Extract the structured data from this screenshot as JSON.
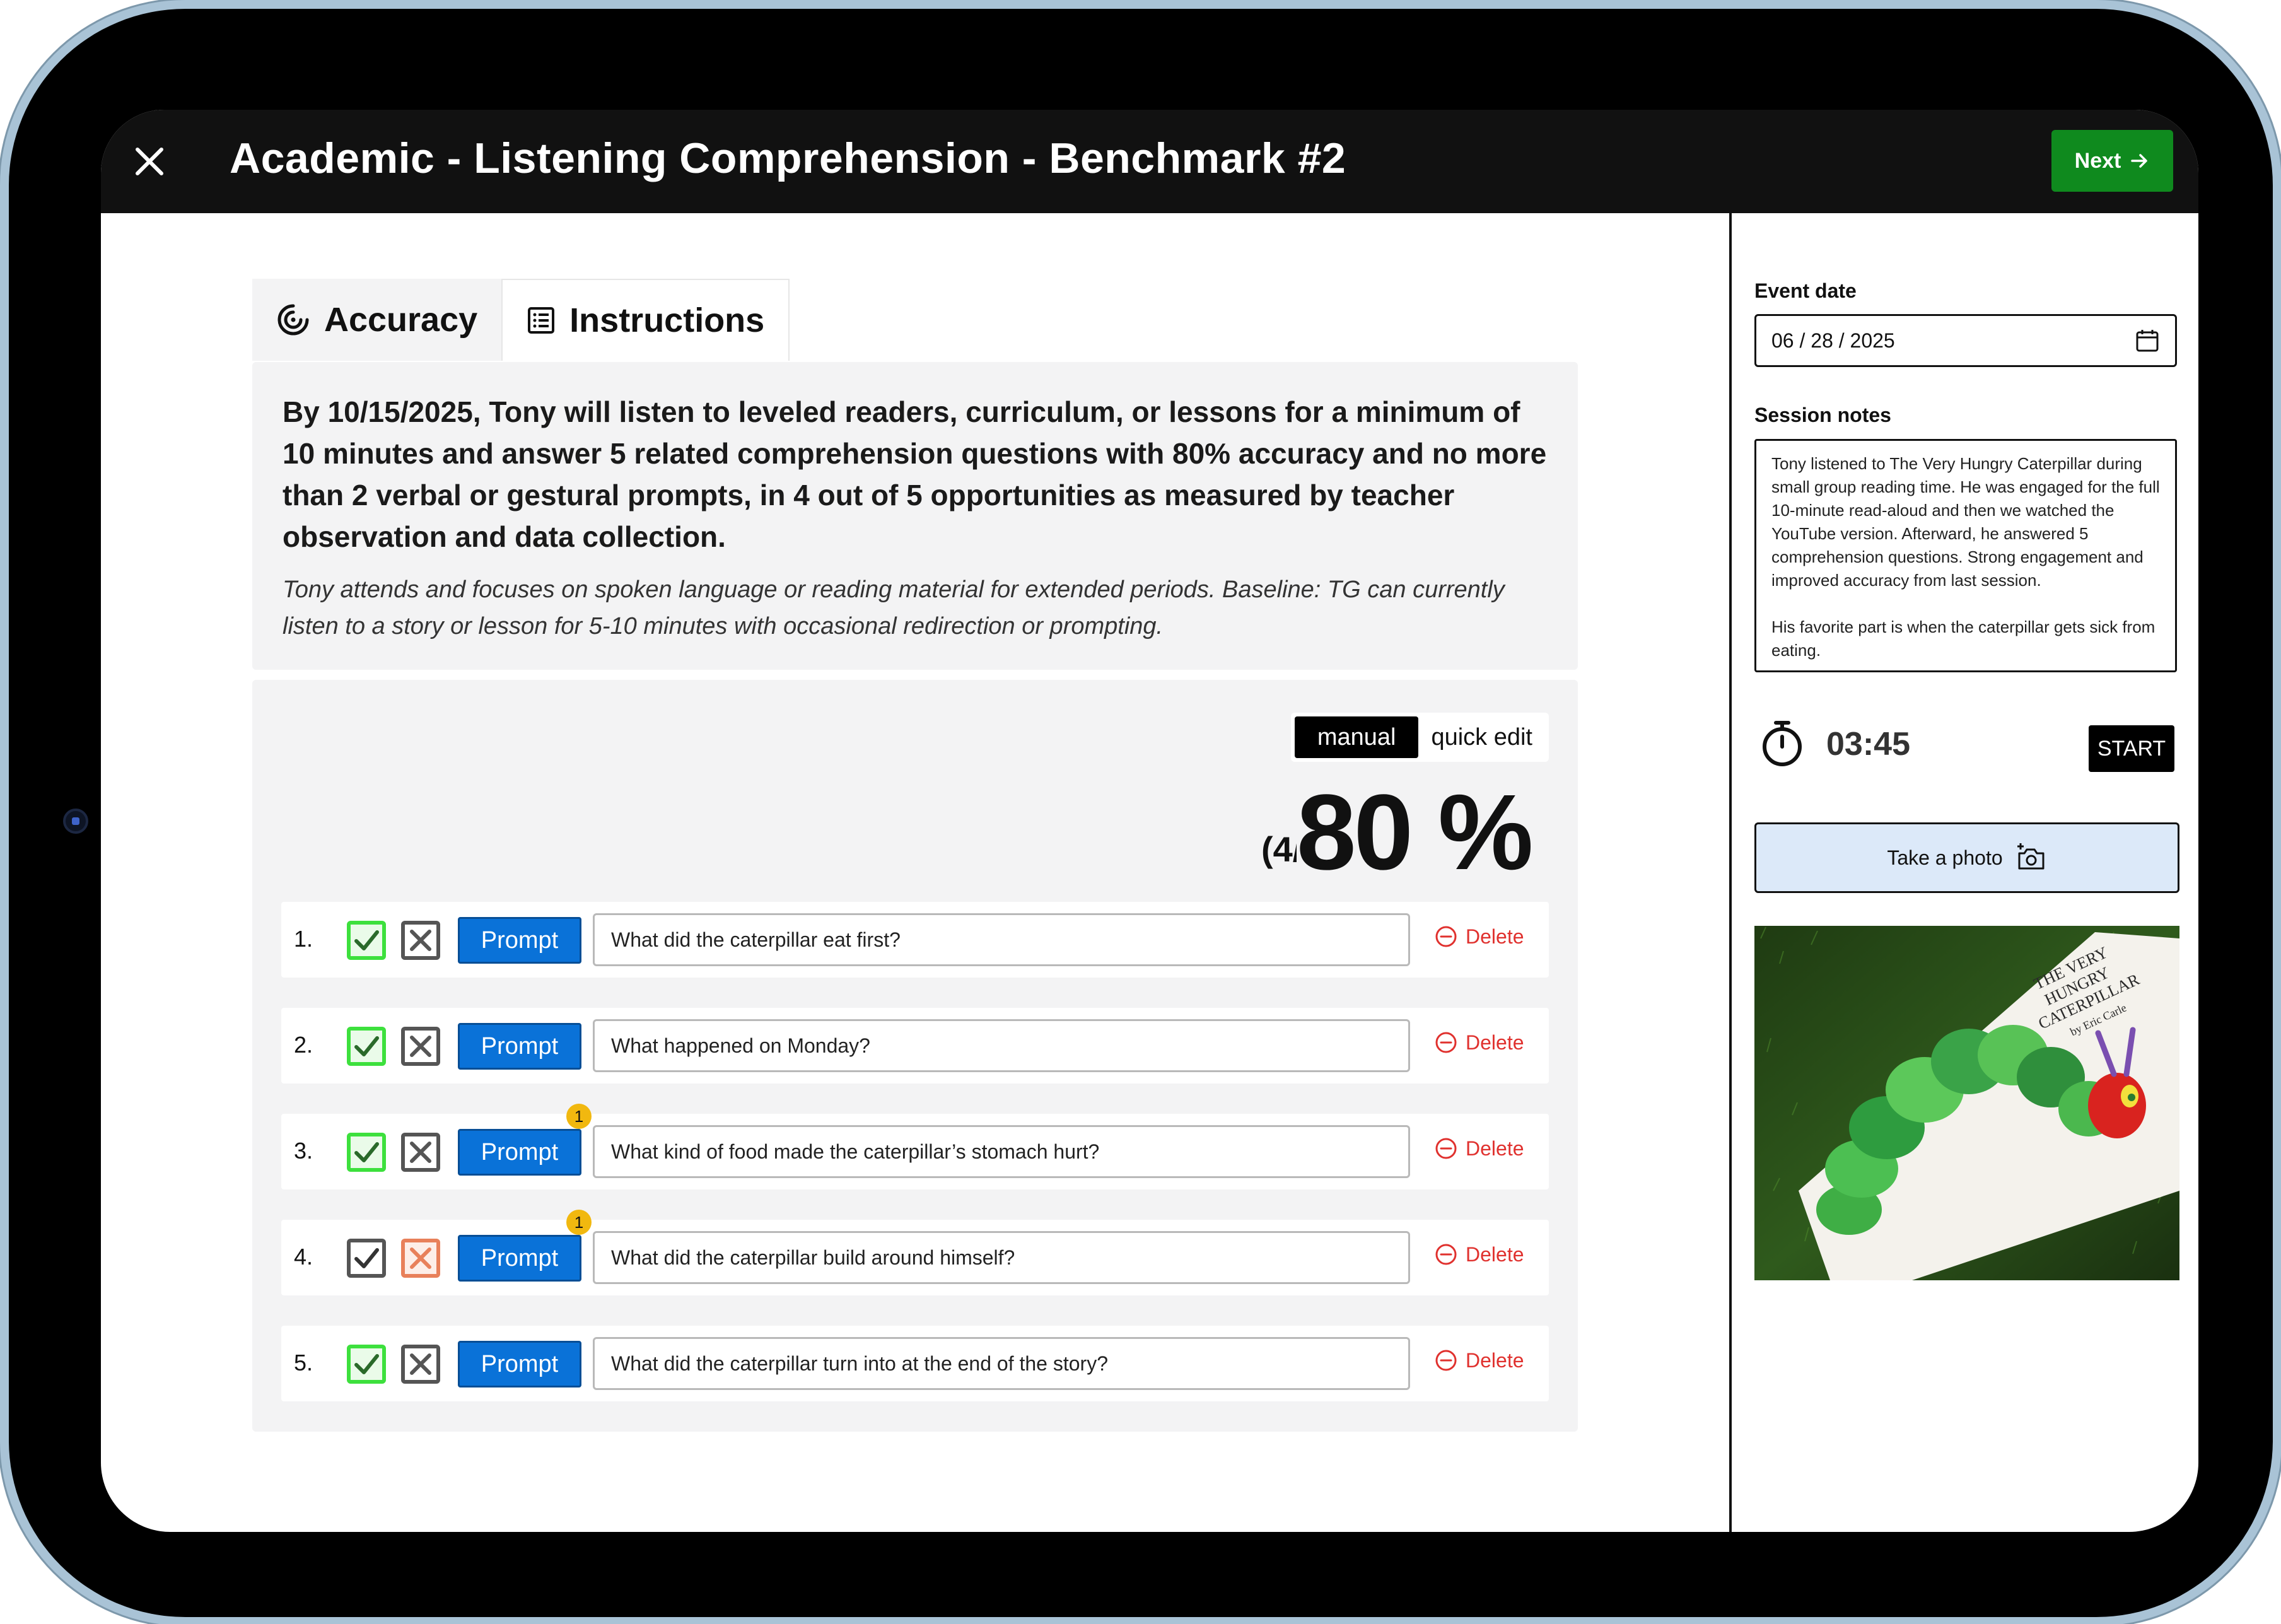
{
  "header": {
    "title": "Academic - Listening Comprehension - Benchmark #2",
    "next_label": "Next"
  },
  "tabs": [
    {
      "label": "Accuracy",
      "icon": "target-icon",
      "active": true
    },
    {
      "label": "Instructions",
      "icon": "list-icon",
      "active": false
    }
  ],
  "goal": {
    "text": "By 10/15/2025, Tony will listen to leveled readers, curriculum, or lessons for a minimum of 10 minutes and answer 5 related comprehension questions with 80% accuracy and no more than 2 verbal or gestural prompts, in 4 out of 5 opportunities as measured by teacher observation and data collection.",
    "baseline": "Tony attends and focuses on spoken language or reading material for extended periods. Baseline: TG can currently listen to a story or lesson for 5-10 minutes with occasional redirection or prompting."
  },
  "mode": {
    "manual": "manual",
    "quick_edit": "quick edit",
    "selected": "manual"
  },
  "score": {
    "count": "(4/5)",
    "percent": "80 %"
  },
  "questions": [
    {
      "num": "1.",
      "text": "What did the caterpillar eat first?",
      "result": "correct",
      "prompt_label": "Prompt",
      "prompt_count": "",
      "delete_label": "Delete"
    },
    {
      "num": "2.",
      "text": "What happened on Monday?",
      "result": "correct",
      "prompt_label": "Prompt",
      "prompt_count": "",
      "delete_label": "Delete"
    },
    {
      "num": "3.",
      "text": "What kind of food made the caterpillar’s stomach hurt?",
      "result": "correct",
      "prompt_label": "Prompt",
      "prompt_count": "1",
      "delete_label": "Delete"
    },
    {
      "num": "4.",
      "text": "What did the caterpillar build around himself?",
      "result": "incorrect",
      "prompt_label": "Prompt",
      "prompt_count": "1",
      "delete_label": "Delete"
    },
    {
      "num": "5.",
      "text": "What did the caterpillar turn into at the end of the story?",
      "result": "correct",
      "prompt_label": "Prompt",
      "prompt_count": "",
      "delete_label": "Delete"
    }
  ],
  "sidebar": {
    "event_date_label": "Event date",
    "event_date": "06 / 28 / 2025",
    "session_notes_label": "Session notes",
    "session_notes": [
      "Tony listened to The Very Hungry Caterpillar during small group reading time. He was engaged for the full 10-minute read-aloud and then we watched the YouTube version. Afterward, he answered 5 comprehension questions. Strong engagement and improved accuracy from last session.",
      "His favorite part is when the caterpillar gets sick from eating."
    ],
    "timer": "03:45",
    "start_label": "START",
    "photo_label": "Take a photo",
    "photo_book": {
      "title_lines": [
        "THE VERY",
        "HUNGRY",
        "CATERPILLAR"
      ],
      "author": "by Eric Carle"
    }
  },
  "colors": {
    "next_green": "#0f8a1e",
    "prompt_blue": "#0a72d8",
    "correct_green": "#3de03d",
    "incorrect_orange": "#e8805a",
    "delete_red": "#e0312e",
    "badge_yellow": "#f1b80f"
  }
}
